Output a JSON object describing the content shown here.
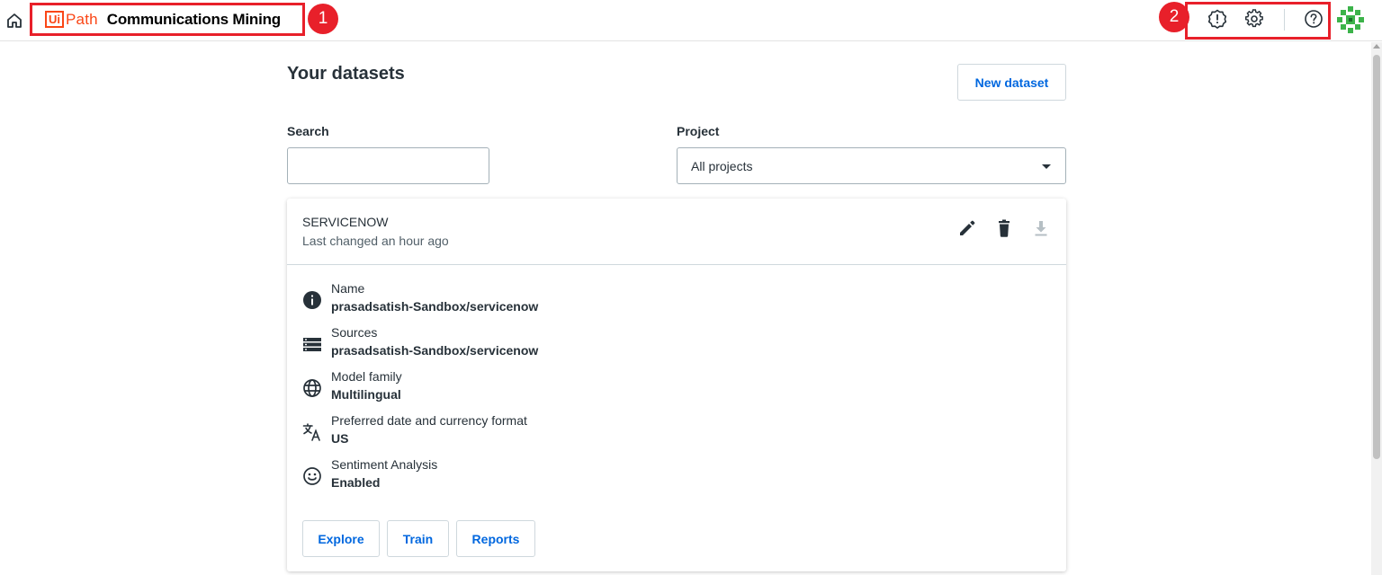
{
  "header": {
    "logo_ui": "Ui",
    "logo_path": "Path",
    "product_name": "Communications Mining",
    "callout_1": "1",
    "callout_2": "2"
  },
  "page": {
    "title": "Your datasets",
    "new_dataset_label": "New dataset"
  },
  "filters": {
    "search_label": "Search",
    "search_value": "",
    "project_label": "Project",
    "project_selected": "All projects"
  },
  "dataset": {
    "title": "SERVICENOW",
    "subtitle": "Last changed an hour ago",
    "details": [
      {
        "icon": "info-icon",
        "label": "Name",
        "value": "prasadsatish-Sandbox/servicenow"
      },
      {
        "icon": "sources-icon",
        "label": "Sources",
        "value": "prasadsatish-Sandbox/servicenow"
      },
      {
        "icon": "globe-icon",
        "label": "Model family",
        "value": "Multilingual"
      },
      {
        "icon": "translate-icon",
        "label": "Preferred date and currency format",
        "value": "US"
      },
      {
        "icon": "smiley-icon",
        "label": "Sentiment Analysis",
        "value": "Enabled"
      }
    ],
    "buttons": {
      "explore": "Explore",
      "train": "Train",
      "reports": "Reports"
    }
  },
  "colors": {
    "accent_blue": "#0067df",
    "callout_red": "#e8202a",
    "uipath_orange": "#fa4616",
    "text_dark": "#273139"
  }
}
